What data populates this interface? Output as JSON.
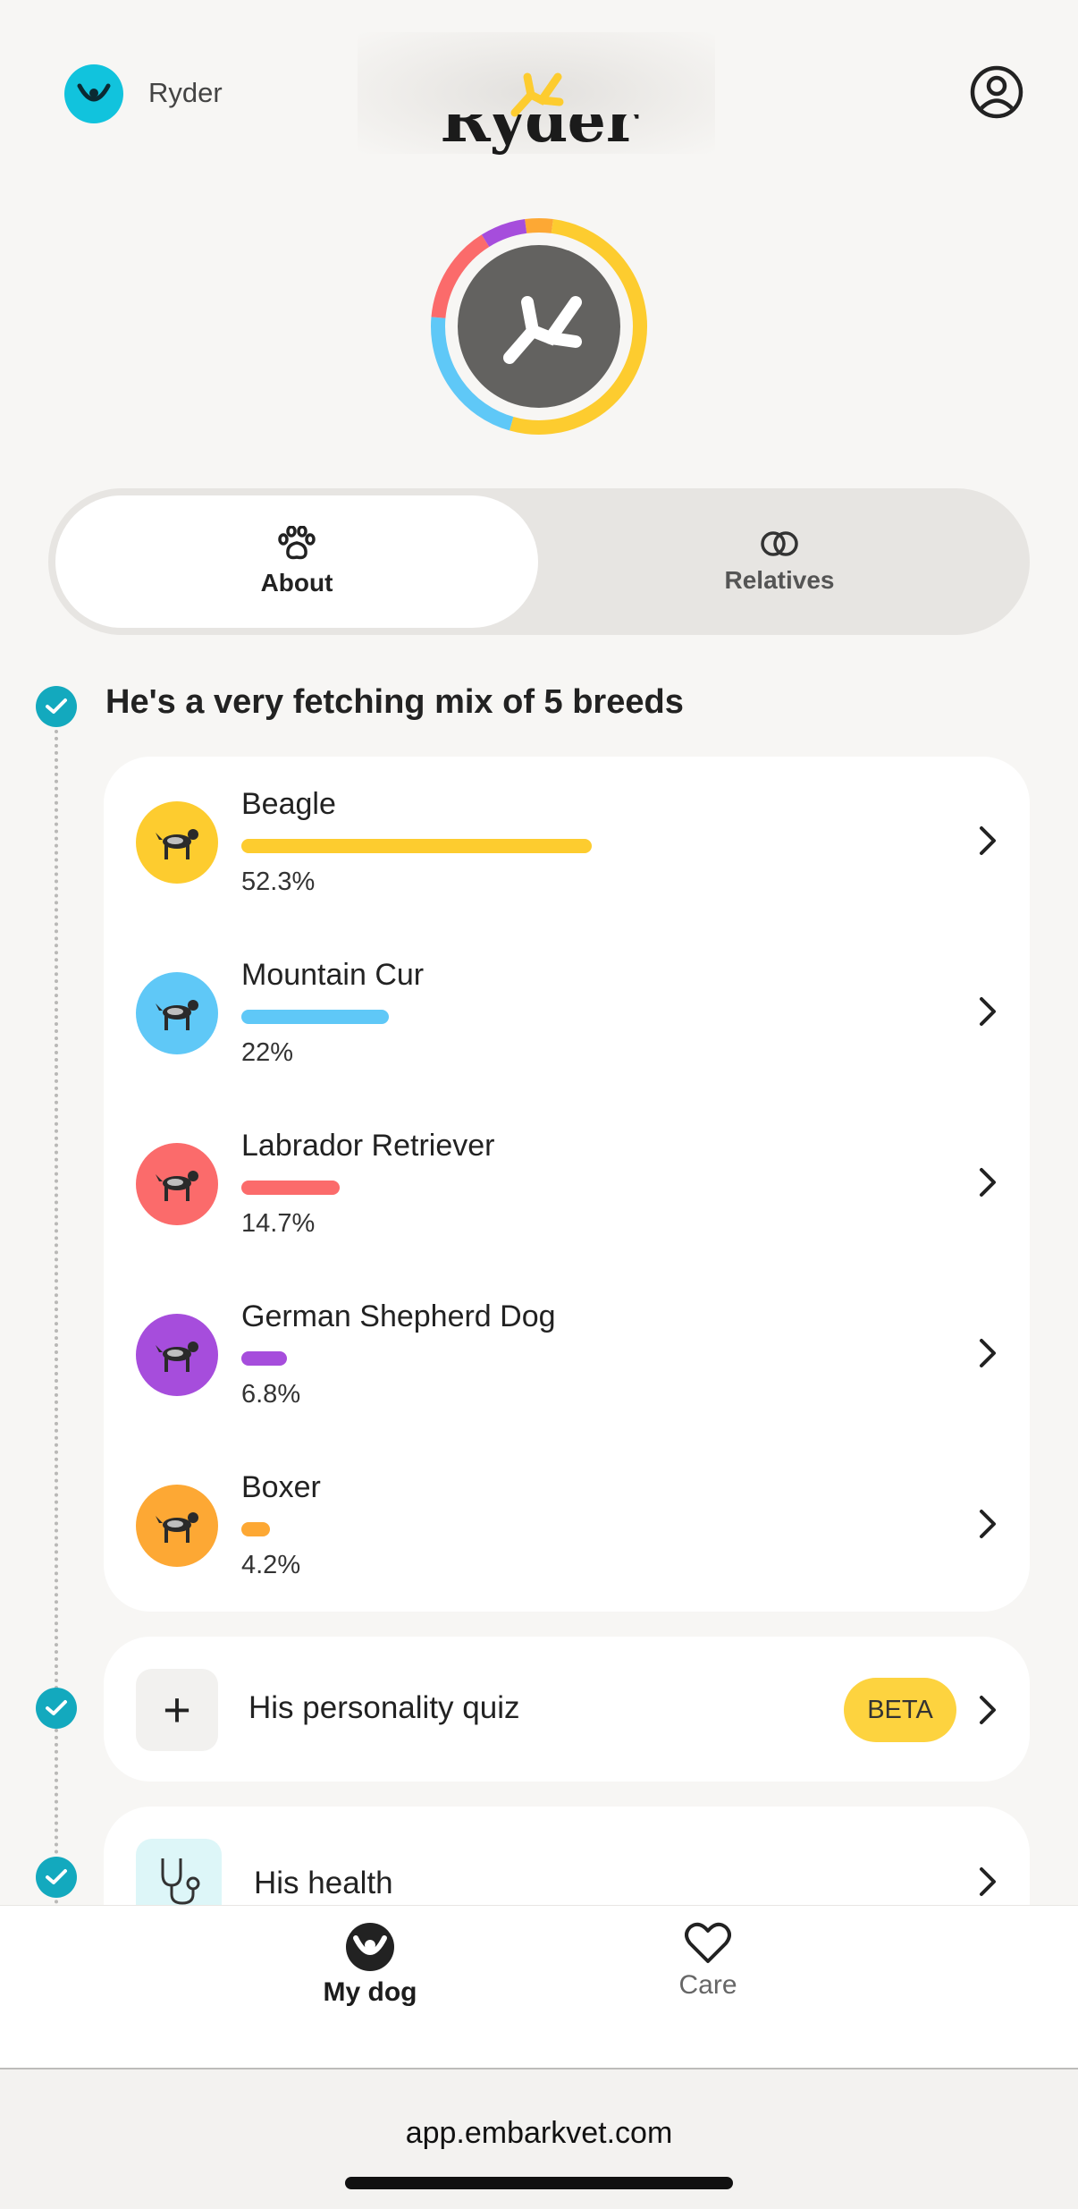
{
  "header": {
    "dog_name": "Ryder",
    "logo_icon": "embark-logo-icon",
    "account_icon": "account-circle-icon"
  },
  "profile": {
    "title": "Ryder",
    "center_icon": "embark-logo-icon"
  },
  "tabs": [
    {
      "label": "About",
      "icon": "paw-icon",
      "active": true
    },
    {
      "label": "Relatives",
      "icon": "rings-icon",
      "active": false
    }
  ],
  "breeds_section": {
    "heading": "He's a very fetching mix of 5 breeds",
    "breeds": [
      {
        "name": "Beagle",
        "percent_label": "52.3%",
        "percent": 52.3,
        "color": "#fdcc2f"
      },
      {
        "name": "Mountain Cur",
        "percent_label": "22%",
        "percent": 22,
        "color": "#5fc8f7"
      },
      {
        "name": "Labrador Retriever",
        "percent_label": "14.7%",
        "percent": 14.7,
        "color": "#fb6b6b"
      },
      {
        "name": "German Shepherd Dog",
        "percent_label": "6.8%",
        "percent": 6.8,
        "color": "#a64ddc"
      },
      {
        "name": "Boxer",
        "percent_label": "4.2%",
        "percent": 4.2,
        "color": "#fda834"
      }
    ]
  },
  "personality": {
    "title": "His personality quiz",
    "badge": "BETA",
    "icon": "plus-icon"
  },
  "health": {
    "title": "His health",
    "icon": "stethoscope-icon"
  },
  "bottom_nav": [
    {
      "label": "My dog",
      "icon": "dog-face-icon",
      "active": true
    },
    {
      "label": "Care",
      "icon": "heart-icon",
      "active": false
    }
  ],
  "browser": {
    "url": "app.embarkvet.com"
  },
  "colors": {
    "teal": "#13a9be",
    "avatar_cyan": "#11c3dd",
    "ring_center": "#636260",
    "beta_yellow": "#fdd33f"
  }
}
